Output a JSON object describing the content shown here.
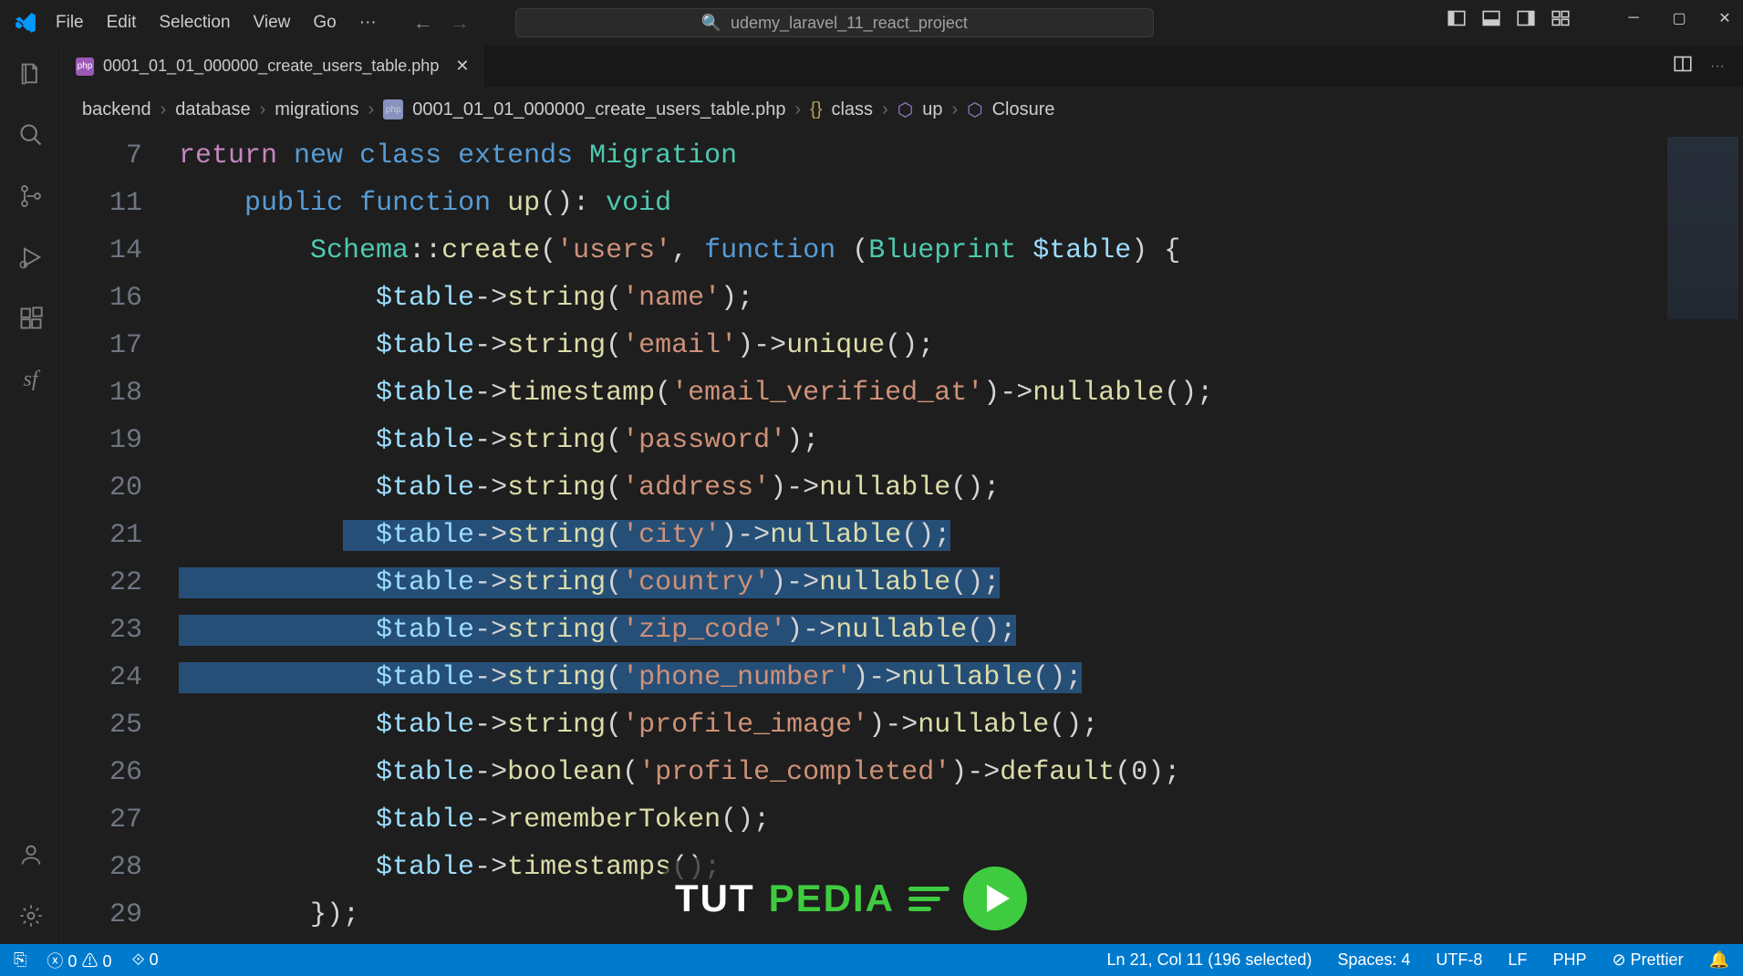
{
  "title_bar": {
    "menu": [
      "File",
      "Edit",
      "Selection",
      "View",
      "Go"
    ],
    "search_placeholder": "udemy_laravel_11_react_project"
  },
  "tab": {
    "filename": "0001_01_01_000000_create_users_table.php"
  },
  "breadcrumb": [
    "backend",
    "database",
    "migrations",
    "0001_01_01_000000_create_users_table.php",
    "class",
    "up",
    "Closure"
  ],
  "editor": {
    "lines": [
      {
        "n": 7,
        "tokens": [
          [
            "k-return",
            "return"
          ],
          [
            "pn",
            " "
          ],
          [
            "k-new",
            "new"
          ],
          [
            "pn",
            " "
          ],
          [
            "k-class",
            "class"
          ],
          [
            "pn",
            " "
          ],
          [
            "k-new",
            "extends"
          ],
          [
            "pn",
            " "
          ],
          [
            "k-type",
            "Migration"
          ]
        ]
      },
      {
        "n": 11,
        "tokens": [
          [
            "pn",
            "    "
          ],
          [
            "pub",
            "public"
          ],
          [
            "pn",
            " "
          ],
          [
            "k-fn",
            "function"
          ],
          [
            "pn",
            " "
          ],
          [
            "m-name",
            "up"
          ],
          [
            "pn",
            "(): "
          ],
          [
            "k-void",
            "void"
          ]
        ]
      },
      {
        "n": 14,
        "tokens": [
          [
            "pn",
            "        "
          ],
          [
            "k-type",
            "Schema"
          ],
          [
            "pn",
            "::"
          ],
          [
            "m-name",
            "create"
          ],
          [
            "pn",
            "("
          ],
          [
            "str",
            "'users'"
          ],
          [
            "pn",
            ", "
          ],
          [
            "k-fn",
            "function"
          ],
          [
            "pn",
            " ("
          ],
          [
            "k-type",
            "Blueprint"
          ],
          [
            "pn",
            " "
          ],
          [
            "v-name",
            "$table"
          ],
          [
            "pn",
            ") {"
          ]
        ]
      },
      {
        "n": 16,
        "tokens": [
          [
            "pn",
            "            "
          ],
          [
            "v-name",
            "$table"
          ],
          [
            "pn",
            "->"
          ],
          [
            "m-name",
            "string"
          ],
          [
            "pn",
            "("
          ],
          [
            "str",
            "'name'"
          ],
          [
            "pn",
            ");"
          ]
        ]
      },
      {
        "n": 17,
        "tokens": [
          [
            "pn",
            "            "
          ],
          [
            "v-name",
            "$table"
          ],
          [
            "pn",
            "->"
          ],
          [
            "m-name",
            "string"
          ],
          [
            "pn",
            "("
          ],
          [
            "str",
            "'email'"
          ],
          [
            "pn",
            ")->"
          ],
          [
            "m-name",
            "unique"
          ],
          [
            "pn",
            "();"
          ]
        ]
      },
      {
        "n": 18,
        "tokens": [
          [
            "pn",
            "            "
          ],
          [
            "v-name",
            "$table"
          ],
          [
            "pn",
            "->"
          ],
          [
            "m-name",
            "timestamp"
          ],
          [
            "pn",
            "("
          ],
          [
            "str",
            "'email_verified_at'"
          ],
          [
            "pn",
            ")->"
          ],
          [
            "m-name",
            "nullable"
          ],
          [
            "pn",
            "();"
          ]
        ]
      },
      {
        "n": 19,
        "tokens": [
          [
            "pn",
            "            "
          ],
          [
            "v-name",
            "$table"
          ],
          [
            "pn",
            "->"
          ],
          [
            "m-name",
            "string"
          ],
          [
            "pn",
            "("
          ],
          [
            "str",
            "'password'"
          ],
          [
            "pn",
            ");"
          ]
        ]
      },
      {
        "n": 20,
        "tokens": [
          [
            "pn",
            "            "
          ],
          [
            "v-name",
            "$table"
          ],
          [
            "pn",
            "->"
          ],
          [
            "m-name",
            "string"
          ],
          [
            "pn",
            "("
          ],
          [
            "str",
            "'address'"
          ],
          [
            "pn",
            ")->"
          ],
          [
            "m-name",
            "nullable"
          ],
          [
            "pn",
            "();"
          ]
        ]
      },
      {
        "n": 21,
        "tokens": [
          [
            "pn",
            "            "
          ],
          [
            "v-name",
            "$table"
          ],
          [
            "pn",
            "->"
          ],
          [
            "m-name",
            "string"
          ],
          [
            "pn",
            "("
          ],
          [
            "str",
            "'city'"
          ],
          [
            "pn",
            ")->"
          ],
          [
            "m-name",
            "nullable"
          ],
          [
            "pn",
            "();"
          ]
        ],
        "sel": "partial"
      },
      {
        "n": 22,
        "tokens": [
          [
            "pn",
            "            "
          ],
          [
            "v-name",
            "$table"
          ],
          [
            "pn",
            "->"
          ],
          [
            "m-name",
            "string"
          ],
          [
            "pn",
            "("
          ],
          [
            "str",
            "'country'"
          ],
          [
            "pn",
            ")->"
          ],
          [
            "m-name",
            "nullable"
          ],
          [
            "pn",
            "();"
          ]
        ],
        "sel": "full"
      },
      {
        "n": 23,
        "tokens": [
          [
            "pn",
            "            "
          ],
          [
            "v-name",
            "$table"
          ],
          [
            "pn",
            "->"
          ],
          [
            "m-name",
            "string"
          ],
          [
            "pn",
            "("
          ],
          [
            "str",
            "'zip_code'"
          ],
          [
            "pn",
            ")->"
          ],
          [
            "m-name",
            "nullable"
          ],
          [
            "pn",
            "();"
          ]
        ],
        "sel": "full"
      },
      {
        "n": 24,
        "tokens": [
          [
            "pn",
            "            "
          ],
          [
            "v-name",
            "$table"
          ],
          [
            "pn",
            "->"
          ],
          [
            "m-name",
            "string"
          ],
          [
            "pn",
            "("
          ],
          [
            "str",
            "'phone_number'"
          ],
          [
            "pn",
            ")->"
          ],
          [
            "m-name",
            "nullable"
          ],
          [
            "pn",
            "();"
          ]
        ],
        "sel": "full"
      },
      {
        "n": 25,
        "tokens": [
          [
            "pn",
            "            "
          ],
          [
            "v-name",
            "$table"
          ],
          [
            "pn",
            "->"
          ],
          [
            "m-name",
            "string"
          ],
          [
            "pn",
            "("
          ],
          [
            "str",
            "'profile_image'"
          ],
          [
            "pn",
            ")->"
          ],
          [
            "m-name",
            "nullable"
          ],
          [
            "pn",
            "();"
          ]
        ]
      },
      {
        "n": 26,
        "tokens": [
          [
            "pn",
            "            "
          ],
          [
            "v-name",
            "$table"
          ],
          [
            "pn",
            "->"
          ],
          [
            "m-name",
            "boolean"
          ],
          [
            "pn",
            "("
          ],
          [
            "str",
            "'profile_completed'"
          ],
          [
            "pn",
            ")->"
          ],
          [
            "m-name",
            "default"
          ],
          [
            "pn",
            "(0);"
          ]
        ]
      },
      {
        "n": 27,
        "tokens": [
          [
            "pn",
            "            "
          ],
          [
            "v-name",
            "$table"
          ],
          [
            "pn",
            "->"
          ],
          [
            "m-name",
            "rememberToken"
          ],
          [
            "pn",
            "();"
          ]
        ]
      },
      {
        "n": 28,
        "tokens": [
          [
            "pn",
            "            "
          ],
          [
            "v-name",
            "$table"
          ],
          [
            "pn",
            "->"
          ],
          [
            "m-name",
            "timestamps"
          ],
          [
            "pn",
            "();"
          ]
        ]
      },
      {
        "n": 29,
        "tokens": [
          [
            "pn",
            "        });"
          ]
        ]
      }
    ]
  },
  "status": {
    "errors": "0",
    "warnings": "0",
    "ports": "0",
    "cursor": "Ln 21, Col 11 (196 selected)",
    "indent": "Spaces: 4",
    "encoding": "UTF-8",
    "eol": "LF",
    "lang": "PHP",
    "formatter": "Prettier"
  },
  "watermark": {
    "t1": "TUT",
    "t2": "PEDIA"
  }
}
